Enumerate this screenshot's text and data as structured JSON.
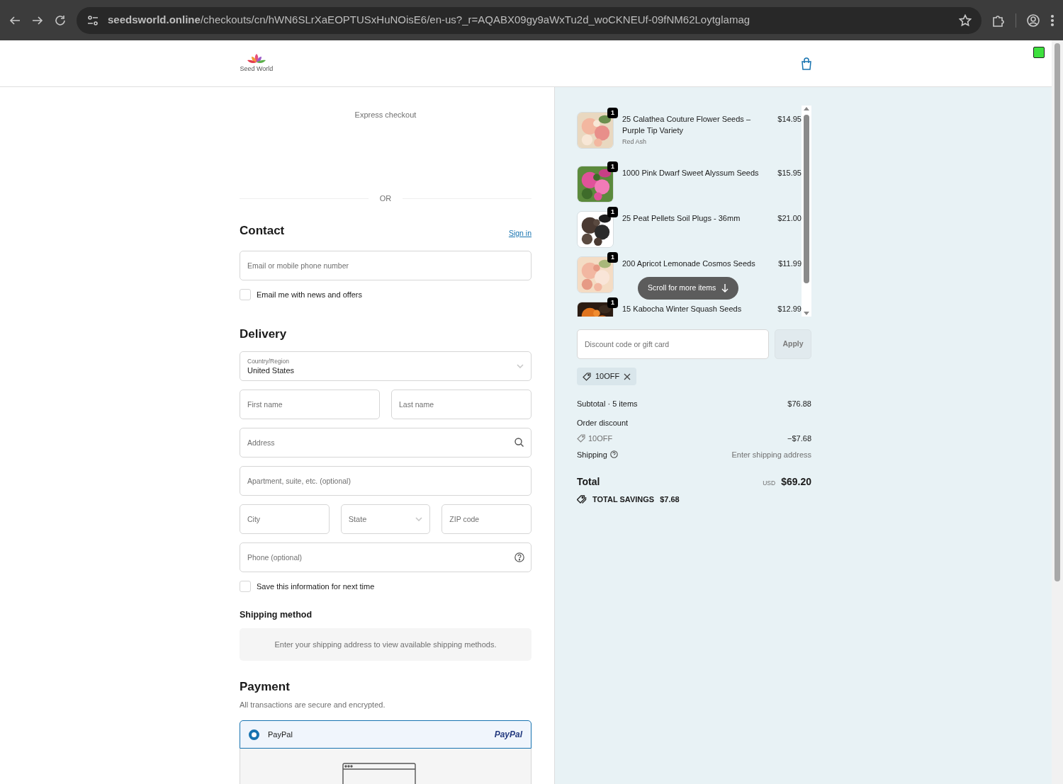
{
  "browser": {
    "url": "**seedsworld.online**/checkouts/cn/hWN6SLrXaEOPTUSxHuNOisE6/en-us?_r=AQABX09gy9aWxTu2d_woCKNEUf-09fNM62Loytglamag"
  },
  "header": {
    "logo_text": "Seed World"
  },
  "express": {
    "title": "Express checkout",
    "divider": "OR"
  },
  "contact": {
    "title": "Contact",
    "sign_in": "Sign in",
    "email_placeholder": "Email or mobile phone number",
    "newsletter": {
      "label": "Email me with news and offers",
      "checked": false
    }
  },
  "delivery": {
    "title": "Delivery",
    "rows": [
      [
        {
          "kind": "floating-select",
          "label": "Country/Region",
          "value": "United States"
        }
      ],
      [
        {
          "kind": "input",
          "placeholder": "First name"
        },
        {
          "kind": "input",
          "placeholder": "Last name"
        }
      ],
      [
        {
          "kind": "search-input",
          "placeholder": "Address"
        }
      ],
      [
        {
          "kind": "input",
          "placeholder": "Apartment, suite, etc. (optional)"
        }
      ],
      [
        {
          "kind": "input",
          "placeholder": "City"
        },
        {
          "kind": "select",
          "label": "State"
        },
        {
          "kind": "input",
          "placeholder": "ZIP code"
        }
      ],
      [
        {
          "kind": "help-input",
          "placeholder": "Phone (optional)"
        }
      ]
    ],
    "save": {
      "label": "Save this information for next time",
      "checked": false
    }
  },
  "shipping_method": {
    "title": "Shipping method",
    "notice": "Enter your shipping address to view available shipping methods."
  },
  "payment": {
    "title": "Payment",
    "subtitle": "All transactions are secure and encrypted.",
    "options": [
      {
        "label": "PayPal",
        "brand": "PayPal",
        "selected": true
      }
    ]
  },
  "summary": {
    "items": [
      {
        "name": "25 Calathea Couture Flower Seeds – Purple Tip Variety",
        "variant": "Red Ash",
        "price": "$14.95",
        "quantity": "1"
      },
      {
        "name": "1000 Pink Dwarf Sweet Alyssum Seeds",
        "price": "$15.95",
        "quantity": "1"
      },
      {
        "name": "25 Peat Pellets Soil Plugs - 36mm",
        "price": "$21.00",
        "quantity": "1"
      },
      {
        "name": "200 Apricot Lemonade Cosmos Seeds",
        "price": "$11.99",
        "quantity": "1"
      },
      {
        "name": "15 Kabocha Winter Squash Seeds",
        "price": "$12.99",
        "quantity": "1"
      }
    ],
    "scroll_hint": "Scroll for more items",
    "discount_placeholder": "Discount code or gift card",
    "apply": "Apply",
    "applied_code": "10OFF",
    "subtotal_label": "Subtotal · 5 items",
    "subtotal": "$76.88",
    "discount_label": "Order discount",
    "discount_code": "10OFF",
    "discount_amount": "−$7.68",
    "shipping_label": "Shipping",
    "shipping_value": "Enter shipping address",
    "total_label": "Total",
    "currency": "USD",
    "total": "$69.20",
    "savings_label": "TOTAL SAVINGS",
    "savings": "$7.68"
  }
}
